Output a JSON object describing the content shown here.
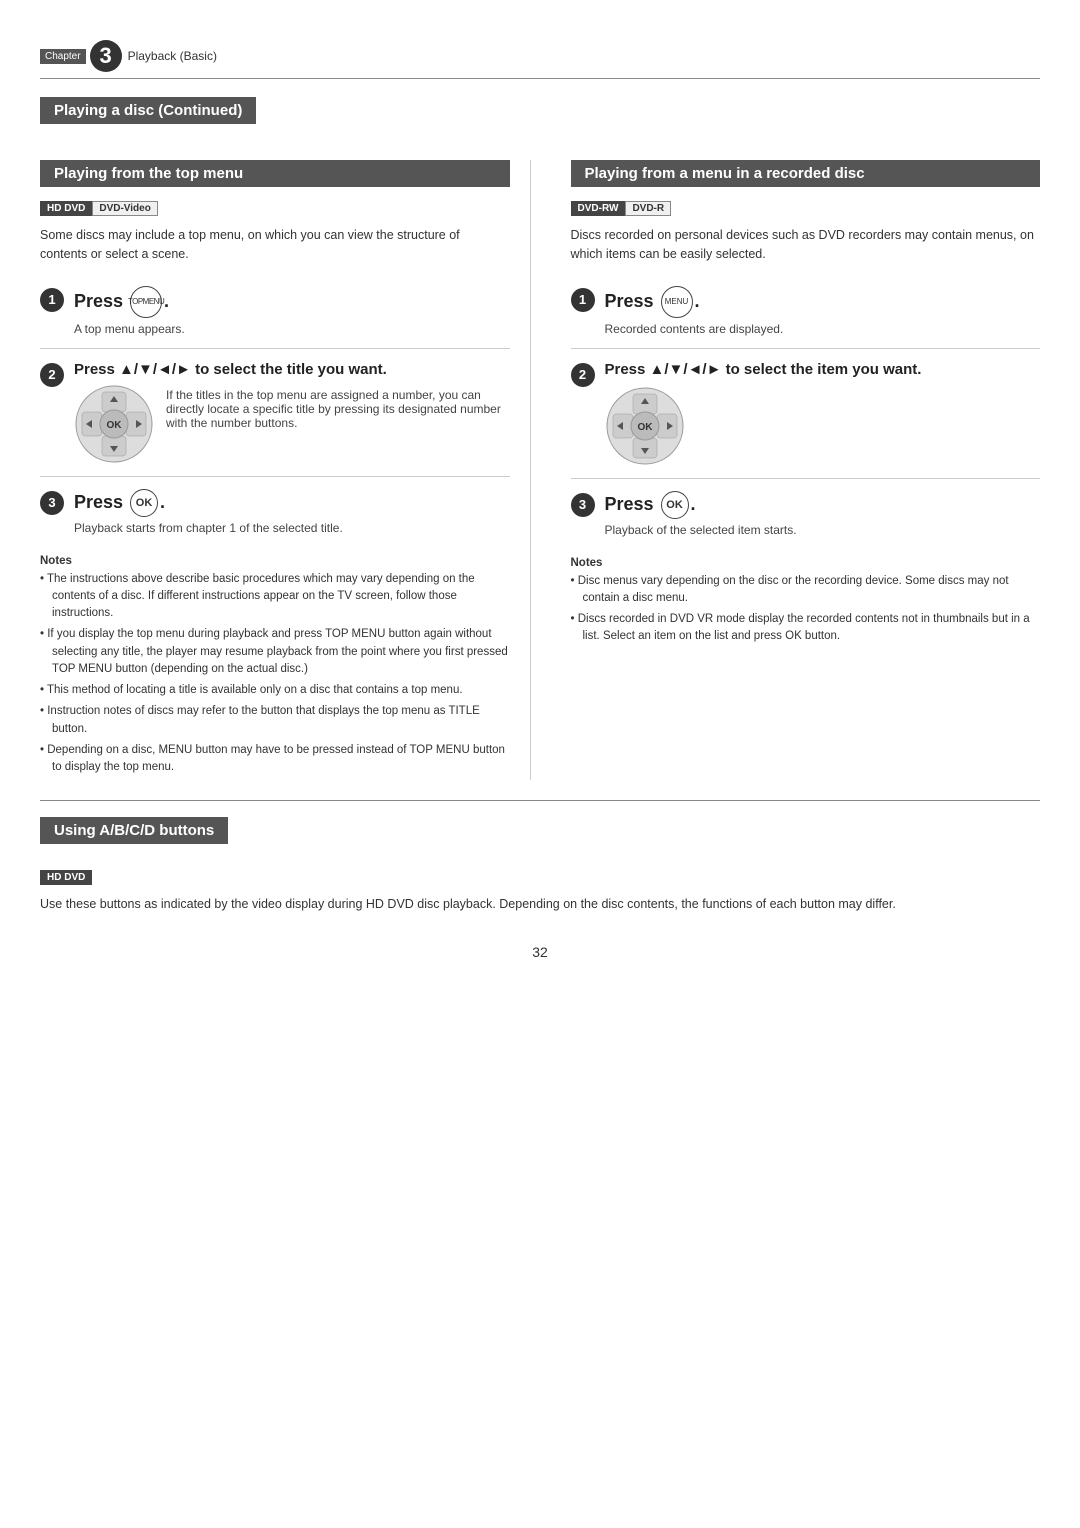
{
  "chapter": {
    "label": "Chapter",
    "number": "3",
    "title": "Playback (Basic)"
  },
  "continuing_banner": "Playing a disc (Continued)",
  "left_section": {
    "title": "Playing from the top menu",
    "disc_badges": [
      "HD DVD",
      "DVD-Video"
    ],
    "description": "Some discs may include a top menu, on which you can view the structure of contents or select a scene.",
    "steps": [
      {
        "number": "1",
        "main": "Press ○.",
        "button_label": "TOPMENU",
        "sub": "A top menu appears."
      },
      {
        "number": "2",
        "main": "Press ▲/▼/◄/► to select the title you want.",
        "image_text": "If the titles in the top menu are assigned a number, you can directly locate a specific title by pressing its designated number with the number buttons."
      },
      {
        "number": "3",
        "main": "Press OK.",
        "sub": "Playback starts from chapter 1 of the selected title."
      }
    ],
    "notes_title": "Notes",
    "notes": [
      "The instructions above describe basic procedures which may vary depending on the contents of a disc. If different instructions appear on the TV screen, follow those instructions.",
      "If you display the top menu during playback and press TOP MENU button again without selecting any title, the player may resume playback from the point where you first pressed TOP MENU button (depending on the actual disc.)",
      "This method of locating a title is available only on a disc that contains a top menu.",
      "Instruction notes of discs may refer to the button that displays the top menu as TITLE button.",
      "Depending on a disc, MENU button may have to be pressed instead of TOP MENU button to display the top menu."
    ]
  },
  "right_section": {
    "title": "Playing from a menu in a recorded disc",
    "disc_badges": [
      "DVD-RW",
      "DVD-R"
    ],
    "description": "Discs recorded on personal devices such as DVD recorders may contain menus, on which items can be easily selected.",
    "steps": [
      {
        "number": "1",
        "main": "Press ○.",
        "button_label": "MENU",
        "sub": "Recorded contents are displayed."
      },
      {
        "number": "2",
        "main": "Press ▲/▼/◄/► to select the item you want.",
        "has_dpad": true
      },
      {
        "number": "3",
        "main": "Press OK.",
        "sub": "Playback of the selected item starts."
      }
    ],
    "notes_title": "Notes",
    "notes": [
      "Disc menus vary depending on the disc or the recording device. Some discs may not contain a disc menu.",
      "Discs recorded in DVD VR mode display the recorded contents not in thumbnails but in a list. Select an item on the list and press OK button."
    ]
  },
  "bottom_section": {
    "title": "Using A/B/C/D buttons",
    "disc_badges": [
      "HD DVD"
    ],
    "description": "Use these buttons as indicated by the video display during HD DVD disc playback. Depending on the disc contents, the functions of each button may differ."
  },
  "page_number": "32"
}
